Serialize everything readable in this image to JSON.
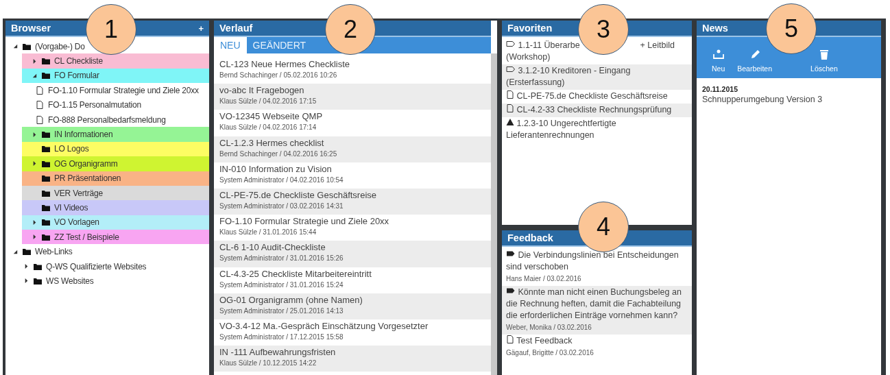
{
  "browser": {
    "title": "Browser",
    "add_label": "+",
    "tree": [
      {
        "label": "(Vorgabe-) Do",
        "kind": "folder",
        "expanded": true,
        "children": [
          {
            "label": "CL Checkliste",
            "kind": "folder",
            "color": "#f9bcd3",
            "expanded": false
          },
          {
            "label": "FO Formular",
            "kind": "folder",
            "color": "#7ff5f7",
            "expanded": true,
            "children": [
              {
                "label": "FO-1.10 Formular Strategie und Ziele 20xx",
                "kind": "document"
              },
              {
                "label": "FO-1.15 Personalmutation",
                "kind": "document"
              },
              {
                "label": "FO-888 Personalbedarfsmeldung",
                "kind": "document"
              }
            ]
          },
          {
            "label": "IN Informationen",
            "kind": "folder",
            "color": "#95f495",
            "expanded": false
          },
          {
            "label": "LO Logos",
            "kind": "folder",
            "color": "#fdfd63"
          },
          {
            "label": "OG Organigramm",
            "kind": "folder",
            "color": "#cff431",
            "expanded": false
          },
          {
            "label": "PR Präsentationen",
            "kind": "folder",
            "color": "#f9b386"
          },
          {
            "label": "VER Verträge",
            "kind": "folder",
            "color": "#dadada"
          },
          {
            "label": "VI Videos",
            "kind": "folder",
            "color": "#c8c8f8"
          },
          {
            "label": "VO Vorlagen",
            "kind": "folder",
            "color": "#b3eef8",
            "expanded": false
          },
          {
            "label": "ZZ Test / Beispiele",
            "kind": "folder",
            "color": "#f8a5f2",
            "expanded": false
          }
        ]
      },
      {
        "label": "Web-Links",
        "kind": "folder",
        "expanded": true,
        "children": [
          {
            "label": "Q-WS Qualifizierte Websites",
            "kind": "folder",
            "expanded": false
          },
          {
            "label": "WS Websites",
            "kind": "folder",
            "expanded": false
          }
        ]
      }
    ]
  },
  "history": {
    "title": "Verlauf",
    "tabs": [
      {
        "label": "NEU",
        "selected": true
      },
      {
        "label": "GEÄNDERT",
        "selected": false
      }
    ],
    "items": [
      {
        "title": "CL-123 Neue Hermes Checkliste",
        "meta": "Bernd Schachinger / 05.02.2016 10:26"
      },
      {
        "title": "vo-abc It Fragebogen",
        "meta": "Klaus Sülzle / 04.02.2016 17:15"
      },
      {
        "title": "VO-12345 Webseite QMP",
        "meta": "Klaus Sülzle / 04.02.2016 17:14"
      },
      {
        "title": "CL-1.2.3 Hermes checklist",
        "meta": "Bernd Schachinger / 04.02.2016 16:25"
      },
      {
        "title": "IN-010 Information zu Vision",
        "meta": "System Administrator / 04.02.2016 10:54"
      },
      {
        "title": "CL-PE-75.de Checkliste Geschäftsreise",
        "meta": "System Administrator / 03.02.2016 14:31"
      },
      {
        "title": "FO-1.10 Formular Strategie und Ziele 20xx",
        "meta": "Klaus Sülzle / 31.01.2016 15:44"
      },
      {
        "title": "CL-6 1-10 Audit-Checkliste",
        "meta": "System Administrator / 31.01.2016 15:26"
      },
      {
        "title": "CL-4.3-25 Checkliste Mitarbeitereintritt",
        "meta": "System Administrator / 31.01.2016 15:24"
      },
      {
        "title": "OG-01 Organigramm (ohne Namen)",
        "meta": "System Administrator / 25.01.2016 14:13"
      },
      {
        "title": "VO-3.4-12 Ma.-Gespräch Einschätzung Vorgesetzter",
        "meta": "System Administrator / 17.12.2015 15:58"
      },
      {
        "title": "IN -111 Aufbewahrungsfristen",
        "meta": "Klaus Sülzle / 10.12.2015 14:22"
      }
    ]
  },
  "favorites": {
    "title": "Favoriten",
    "items": [
      {
        "kind": "tag",
        "text": "1.1-11 Überarbe",
        "text_after": "+ Leitbild (Workshop)"
      },
      {
        "kind": "tag",
        "text": "3.1.2-10 Kreditoren - Eingang (Ersterfassung)"
      },
      {
        "kind": "document",
        "text": "CL-PE-75.de Checkliste Geschäftsreise"
      },
      {
        "kind": "document",
        "text": "CL-4.2-33 Checkliste Rechnungsprüfung"
      },
      {
        "kind": "warning",
        "text": "1.2.3-10 Ungerechtfertigte Lieferantenrechnungen"
      }
    ]
  },
  "feedback": {
    "title": "Feedback",
    "items": [
      {
        "kind": "tag",
        "text": "Die Verbindungslinien bei Entscheidungen sind verschoben",
        "meta": "Hans Maier / 03.02.2016"
      },
      {
        "kind": "tag",
        "text": "Könnte man nicht einen Buchungsbeleg an die Rechnung heften, damit die Fachabteilung die erforderlichen Einträge vornehmen kann?",
        "meta": "Weber, Monika / 03.02.2016"
      },
      {
        "kind": "document",
        "text": "Test Feedback",
        "meta": "Gägauf, Brigitte / 03.02.2016"
      }
    ]
  },
  "news": {
    "title": "News",
    "actions": [
      {
        "kind": "new",
        "label": "Neu"
      },
      {
        "kind": "edit",
        "label": "Bearbeiten"
      },
      {
        "kind": "delete",
        "label": "Löschen"
      }
    ],
    "items": [
      {
        "date": "20.11.2015",
        "text": "Schnupperumgebung Version 3"
      }
    ]
  },
  "callouts": [
    "1",
    "2",
    "3",
    "4",
    "5"
  ]
}
